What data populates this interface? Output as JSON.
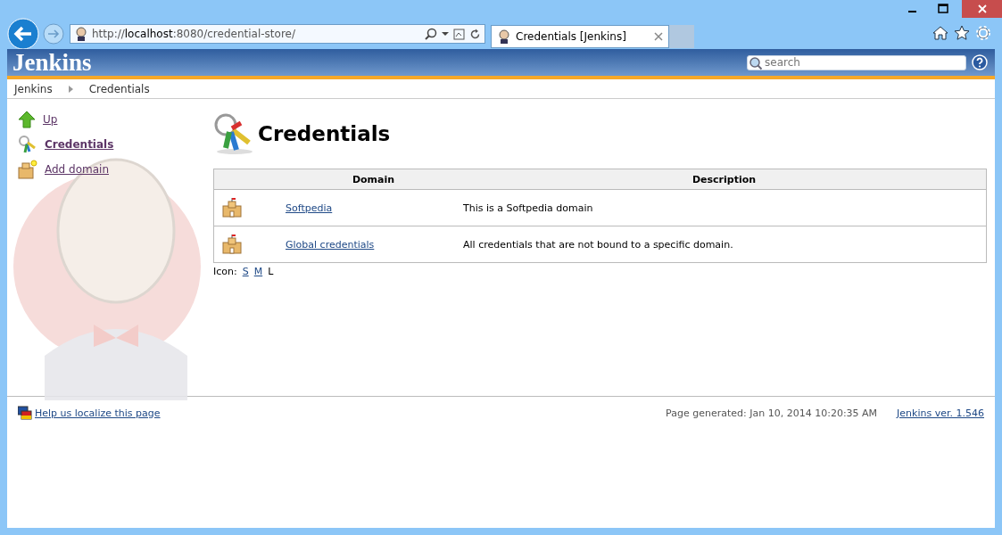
{
  "browser": {
    "address": "http://**localhost**:8080/credential-store/",
    "tab_title": "Credentials [Jenkins]"
  },
  "header": {
    "logo": "Jenkins",
    "search": {
      "placeholder": "search"
    }
  },
  "breadcrumbs": [
    "Jenkins",
    "Credentials"
  ],
  "sidebar": {
    "items": [
      {
        "kind": "up",
        "label": "Up",
        "selected": false
      },
      {
        "kind": "credentials",
        "label": "Credentials",
        "selected": true
      },
      {
        "kind": "add-domain",
        "label": "Add domain",
        "selected": false
      }
    ]
  },
  "page_title": "Credentials",
  "table": {
    "columns": [
      "Domain",
      "Description"
    ],
    "rows": [
      {
        "domain": "Softpedia",
        "description": "This is a Softpedia domain"
      },
      {
        "domain": "Global credentials",
        "description": "All credentials that are not bound to a specific domain."
      }
    ]
  },
  "icon_sizes": {
    "label": "Icon:",
    "options": [
      {
        "label": "S",
        "selected": false
      },
      {
        "label": "M",
        "selected": false
      },
      {
        "label": "L",
        "selected": true
      }
    ]
  },
  "footer": {
    "localize": "Help us localize this page",
    "generated": "Page generated: Jan 10, 2014 10:20:35 AM",
    "version": "Jenkins ver. 1.546"
  }
}
